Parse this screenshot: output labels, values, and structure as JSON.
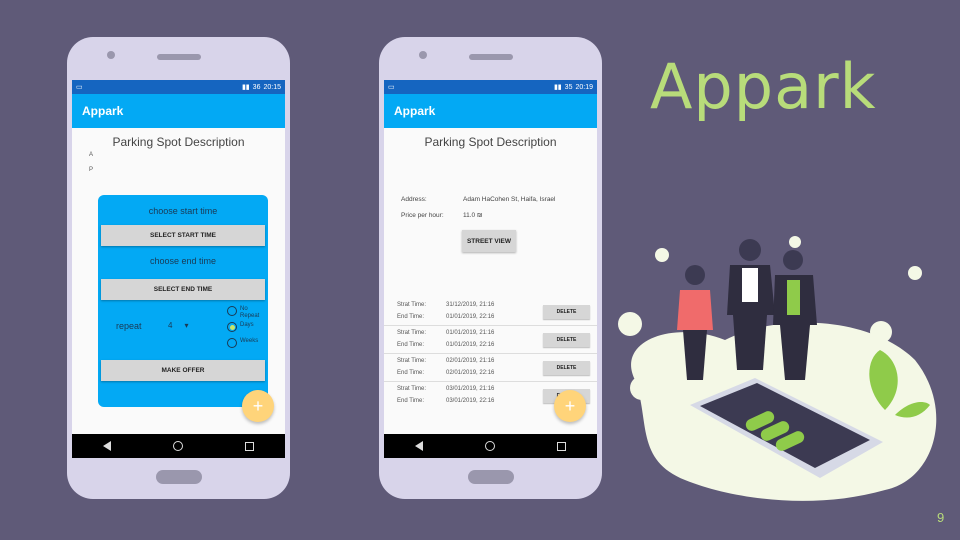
{
  "brand": "Appark",
  "page_number": "9",
  "phone1": {
    "status_time": "20:15",
    "status_battery": "36",
    "app_title": "Appark",
    "page_title": "Parking Spot Description",
    "bg_letter_a": "A",
    "bg_letter_p": "P",
    "dialog": {
      "start_label": "choose start time",
      "start_button": "SELECT START TIME",
      "end_label": "choose end time",
      "end_button": "SELECT END TIME",
      "repeat_label": "repeat",
      "repeat_value": "4",
      "repeat_options": [
        "No Repeat",
        "Days",
        "Weeks"
      ],
      "repeat_selected": "Days",
      "offer_button": "MAKE OFFER"
    },
    "fab": "+"
  },
  "phone2": {
    "status_time": "20:19",
    "status_battery": "35",
    "app_title": "Appark",
    "page_title": "Parking Spot Description",
    "address_label": "Address:",
    "address_value": "Adam HaCohen St, Haifa, Israel",
    "price_label": "Price per hour:",
    "price_value": "11.0 ₪",
    "street_view_button": "STREET VIEW",
    "slots": [
      {
        "start_label": "Strat Time:",
        "start": "31/12/2019, 21:16",
        "end_label": "End Time:",
        "end": "01/01/2019, 22:16",
        "delete": "DELETE"
      },
      {
        "start_label": "Strat Time:",
        "start": "01/01/2019, 21:16",
        "end_label": "End Time:",
        "end": "01/01/2019, 22:16",
        "delete": "DELETE"
      },
      {
        "start_label": "Strat Time:",
        "start": "02/01/2019, 21:16",
        "end_label": "End Time:",
        "end": "02/01/2019, 22:16",
        "delete": "DELETE"
      },
      {
        "start_label": "Strat Time:",
        "start": "03/01/2019, 21:16",
        "end_label": "End Time:",
        "end": "03/01/2019, 22:16",
        "delete": "DELETE"
      }
    ],
    "fab": "+"
  },
  "colors": {
    "background": "#5f5a78",
    "accent_green": "#b8dc7a",
    "app_bar": "#03a9f4",
    "status_bar": "#1565c0",
    "fab": "#ffd47a"
  }
}
